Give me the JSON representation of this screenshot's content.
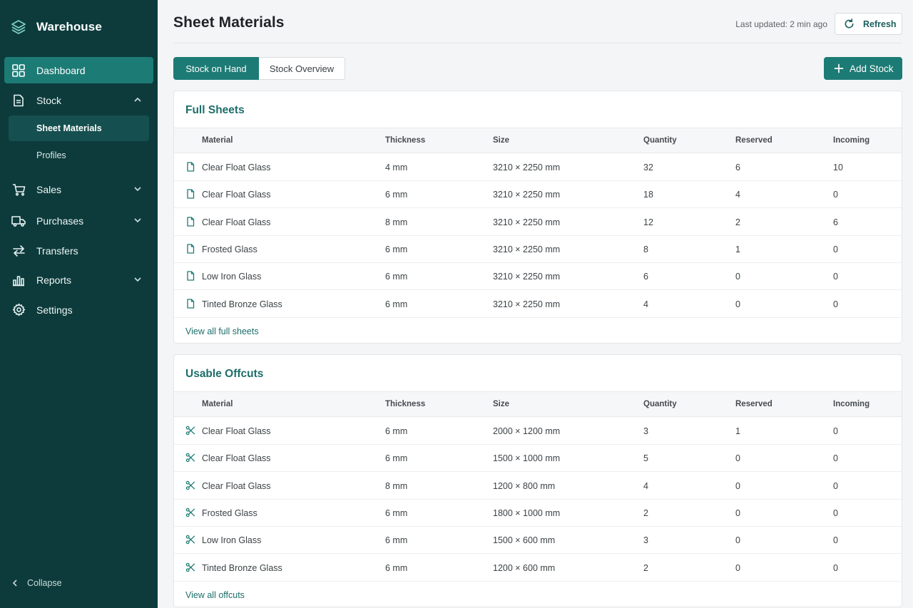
{
  "app": {
    "name": "Warehouse"
  },
  "sidebar": {
    "items": [
      {
        "label": "Dashboard",
        "icon": "dashboard-icon"
      },
      {
        "label": "Stock",
        "icon": "document-icon"
      },
      {
        "label": "Sales",
        "icon": "cart-icon"
      },
      {
        "label": "Purchases",
        "icon": "truck-icon"
      },
      {
        "label": "Transfers",
        "icon": "transfer-icon"
      },
      {
        "label": "Reports",
        "icon": "bar-chart-icon"
      },
      {
        "label": "Settings",
        "icon": "gear-icon"
      }
    ],
    "stock_sub": [
      {
        "label": "Sheet Materials"
      },
      {
        "label": "Profiles"
      }
    ],
    "collapse_label": "Collapse"
  },
  "header": {
    "title": "Sheet Materials",
    "last_updated": "Last updated: 2 min ago",
    "refresh_label": "Refresh"
  },
  "tabs": [
    {
      "label": "Stock on Hand"
    },
    {
      "label": "Stock Overview"
    }
  ],
  "add_stock_label": "Add Stock",
  "columns": [
    "Material",
    "Thickness",
    "Size",
    "Quantity",
    "Reserved",
    "Incoming"
  ],
  "full_sheets": {
    "title": "Full Sheets",
    "rows": [
      {
        "material": "Clear Float Glass",
        "thickness": "4 mm",
        "size": "3210 × 2250 mm",
        "quantity": "32",
        "reserved": "6",
        "incoming": "10"
      },
      {
        "material": "Clear Float Glass",
        "thickness": "6 mm",
        "size": "3210 × 2250 mm",
        "quantity": "18",
        "reserved": "4",
        "incoming": "0"
      },
      {
        "material": "Clear Float Glass",
        "thickness": "8 mm",
        "size": "3210 × 2250 mm",
        "quantity": "12",
        "reserved": "2",
        "incoming": "6"
      },
      {
        "material": "Frosted Glass",
        "thickness": "6 mm",
        "size": "3210 × 2250 mm",
        "quantity": "8",
        "reserved": "1",
        "incoming": "0"
      },
      {
        "material": "Low Iron Glass",
        "thickness": "6 mm",
        "size": "3210 × 2250 mm",
        "quantity": "6",
        "reserved": "0",
        "incoming": "0"
      },
      {
        "material": "Tinted Bronze Glass",
        "thickness": "6 mm",
        "size": "3210 × 2250 mm",
        "quantity": "4",
        "reserved": "0",
        "incoming": "0"
      }
    ],
    "view_all": "View all full sheets"
  },
  "offcuts": {
    "title": "Usable Offcuts",
    "rows": [
      {
        "material": "Clear Float Glass",
        "thickness": "6 mm",
        "size": "2000 × 1200 mm",
        "quantity": "3",
        "reserved": "1",
        "incoming": "0"
      },
      {
        "material": "Clear Float Glass",
        "thickness": "6 mm",
        "size": "1500 × 1000 mm",
        "quantity": "5",
        "reserved": "0",
        "incoming": "0"
      },
      {
        "material": "Clear Float Glass",
        "thickness": "8 mm",
        "size": "1200 × 800 mm",
        "quantity": "4",
        "reserved": "0",
        "incoming": "0"
      },
      {
        "material": "Frosted Glass",
        "thickness": "6 mm",
        "size": "1800 × 1000 mm",
        "quantity": "2",
        "reserved": "0",
        "incoming": "0"
      },
      {
        "material": "Low Iron Glass",
        "thickness": "6 mm",
        "size": "1500 × 600 mm",
        "quantity": "3",
        "reserved": "0",
        "incoming": "0"
      },
      {
        "material": "Tinted Bronze Glass",
        "thickness": "6 mm",
        "size": "1200 × 600 mm",
        "quantity": "2",
        "reserved": "0",
        "incoming": "0"
      }
    ],
    "view_all": "View all offcuts"
  },
  "colors": {
    "sidebar_bg": "#0d3b3c",
    "accent": "#1d7b75",
    "title_accent": "#1d6e6a"
  }
}
